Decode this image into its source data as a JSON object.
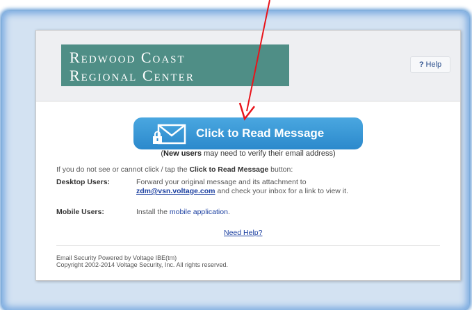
{
  "logo": {
    "line1": "Redwood Coast",
    "line2": "Regional Center"
  },
  "help": {
    "icon": "?",
    "label": "Help"
  },
  "read_button": {
    "label": "Click to Read Message"
  },
  "new_users": {
    "open": "(",
    "bold": "New users",
    "rest": " may need to verify their email address)"
  },
  "instructions": {
    "prefix": "If you do not see or cannot click / tap the ",
    "bold": "Click to Read Message",
    "suffix": " button:"
  },
  "desktop": {
    "label": "Desktop Users:",
    "text1": "Forward your original message and its attachment to",
    "email": "zdm@vsn.voltage.com",
    "text2": " and check your inbox for a link to view it."
  },
  "mobile": {
    "label": "Mobile Users:",
    "text": "Install the ",
    "link": "mobile application",
    "end": "."
  },
  "need_help": "Need Help?",
  "footer": {
    "line1": "Email Security Powered by Voltage IBE(tm)",
    "line2": "Copyright 2002-2014 Voltage Security, Inc. All rights reserved."
  },
  "colors": {
    "frame_glow": "#5f98d3",
    "logo_bg": "#4f8e86",
    "button": "#2b89cc",
    "link": "#1b3fa0",
    "annotation_arrow": "#e8141b"
  },
  "icons": [
    "envelope-lock-icon",
    "help-question-icon",
    "annotation-arrow"
  ]
}
